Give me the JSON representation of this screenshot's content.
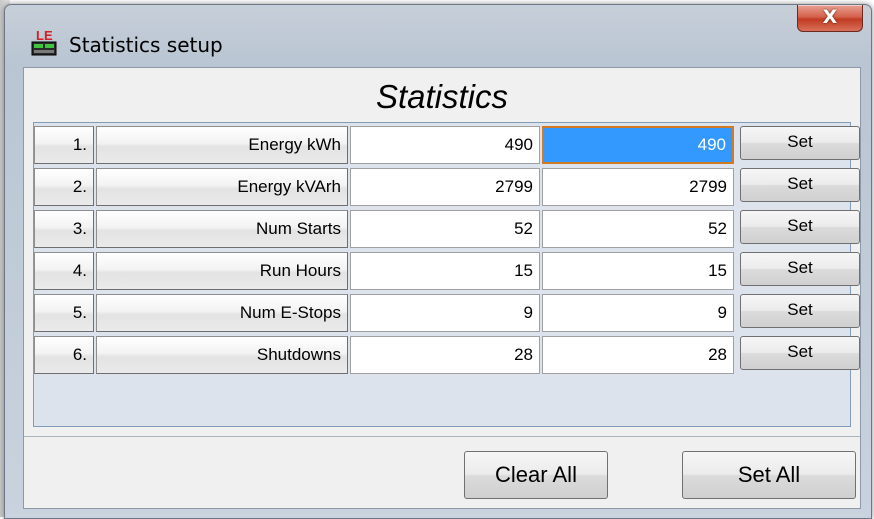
{
  "window": {
    "title": "Statistics setup",
    "close_label": "X"
  },
  "icons": {
    "app": "le-app-icon",
    "close": "close-icon"
  },
  "heading": "Statistics",
  "rows": [
    {
      "num": "1.",
      "name": "Energy kWh",
      "current": "490",
      "new": "490",
      "set_label": "Set"
    },
    {
      "num": "2.",
      "name": "Energy kVArh",
      "current": "2799",
      "new": "2799",
      "set_label": "Set"
    },
    {
      "num": "3.",
      "name": "Num Starts",
      "current": "52",
      "new": "52",
      "set_label": "Set"
    },
    {
      "num": "4.",
      "name": "Run Hours",
      "current": "15",
      "new": "15",
      "set_label": "Set"
    },
    {
      "num": "5.",
      "name": "Num E-Stops",
      "current": "9",
      "new": "9",
      "set_label": "Set"
    },
    {
      "num": "6.",
      "name": "Shutdowns",
      "current": "28",
      "new": "28",
      "set_label": "Set"
    }
  ],
  "buttons": {
    "clear_all": "Clear All",
    "set_all": "Set All"
  },
  "colors": {
    "selection": "#3399ff",
    "focus_border": "#d07a26",
    "close_button": "#c23b22"
  }
}
